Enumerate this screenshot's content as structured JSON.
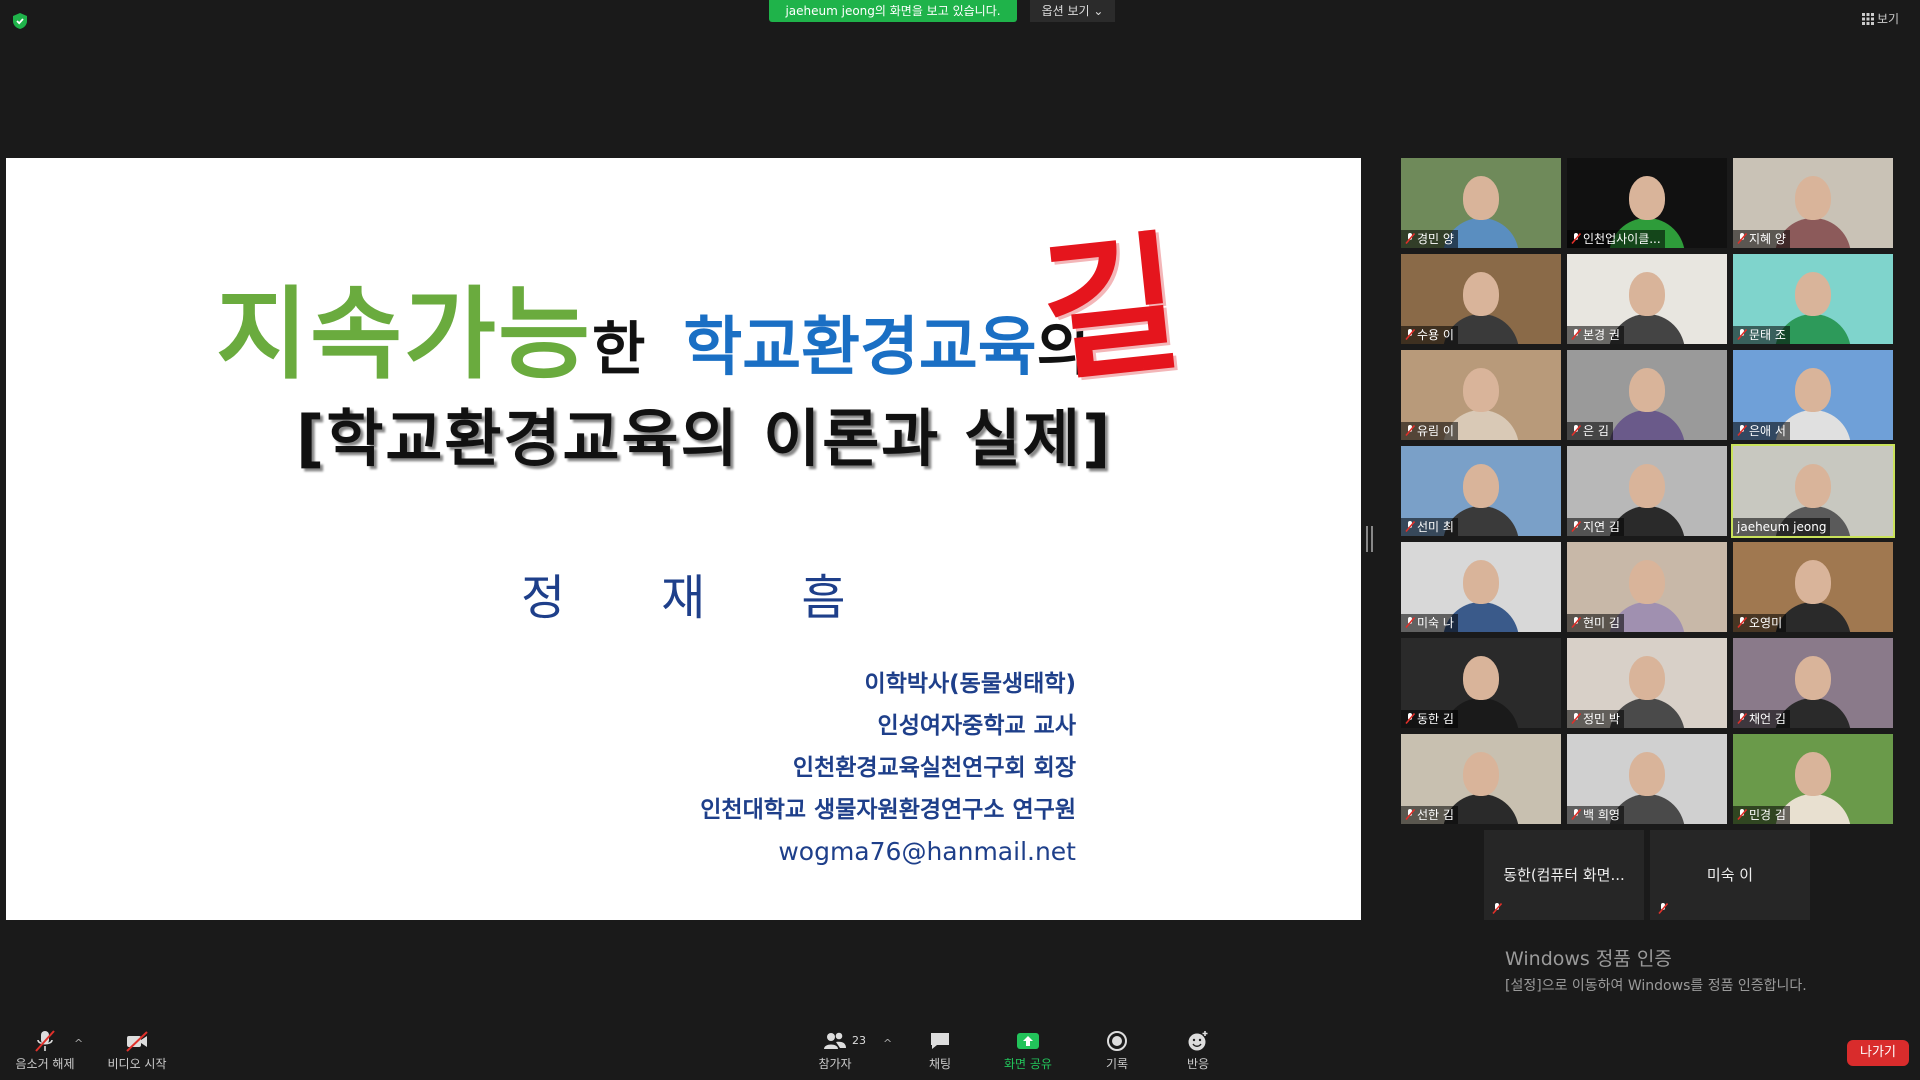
{
  "topbar": {
    "share_banner": "jaeheum jeong의 화면을 보고 있습니다.",
    "view_options": "옵션 보기 ⌄",
    "view_button": "보기"
  },
  "slide": {
    "title_green": "지속가능",
    "title_black1": "한",
    "title_blue": "학교환경교육",
    "title_black2": "의",
    "title_red": "길",
    "subtitle": "[학교환경교육의 이론과 실제]",
    "author": "정재흠",
    "bio": [
      "이학박사(동물생태학)",
      "인성여자중학교 교사",
      "인천환경교육실천연구회 회장",
      "인천대학교 생물자원환경연구소 연구원"
    ],
    "email": "wogma76@hanmail.net"
  },
  "participants": [
    {
      "name": "경민 양",
      "bg": "#6f8a5a",
      "shirt": "#5a8ec0"
    },
    {
      "name": "인천업사이클...",
      "bg": "#111111",
      "shirt": "#2e9c3a"
    },
    {
      "name": "지혜 양",
      "bg": "#c9c2b6",
      "shirt": "#8c5a5a"
    },
    {
      "name": "수용 이",
      "bg": "#8a6a48",
      "shirt": "#3a3a3a"
    },
    {
      "name": "본경 권",
      "bg": "#e8e6e0",
      "shirt": "#444444"
    },
    {
      "name": "문태 조",
      "bg": "#7fd4cc",
      "shirt": "#2d9a5a"
    },
    {
      "name": "유림 이",
      "bg": "#b89a7a",
      "shirt": "#d9c9b6"
    },
    {
      "name": "은 김",
      "bg": "#9a9a9a",
      "shirt": "#6a5a8a"
    },
    {
      "name": "은애 서",
      "bg": "#6fa0d8",
      "shirt": "#e0e0e0"
    },
    {
      "name": "선미 최",
      "bg": "#7aa0c8",
      "shirt": "#3a3a3a"
    },
    {
      "name": "지연 김",
      "bg": "#b8b8b8",
      "shirt": "#2a2a2a"
    },
    {
      "name": "jaeheum jeong",
      "bg": "#c8c8c0",
      "shirt": "#5a5a5a"
    },
    {
      "name": "미숙 나",
      "bg": "#d8d8d8",
      "shirt": "#3a5a8a"
    },
    {
      "name": "현미 김",
      "bg": "#c8b8a8",
      "shirt": "#a090b0"
    },
    {
      "name": "오영미",
      "bg": "#a07850",
      "shirt": "#2a2a2a"
    },
    {
      "name": "동한 김",
      "bg": "#2a2a2a",
      "shirt": "#1a1a1a"
    },
    {
      "name": "정민 박",
      "bg": "#d8d0c8",
      "shirt": "#4a4a4a"
    },
    {
      "name": "채언 김",
      "bg": "#8a7a8a",
      "shirt": "#2a2a2a"
    },
    {
      "name": "선한 김",
      "bg": "#c8c0b0",
      "shirt": "#2a2a2a"
    },
    {
      "name": "백 희영",
      "bg": "#d0d0d0",
      "shirt": "#4a4a4a"
    },
    {
      "name": "민경 김",
      "bg": "#6a9a4a",
      "shirt": "#e8e0d0"
    }
  ],
  "name_tiles": [
    {
      "name": "동한(컴퓨터 화면..."
    },
    {
      "name": "미숙 이"
    }
  ],
  "activation": {
    "line1": "Windows 정품 인증",
    "line2": "[설정]으로 이동하여 Windows를 정품 인증합니다."
  },
  "toolbar": {
    "unmute": "음소거 해제",
    "start_video": "비디오 시작",
    "participants": "참가자",
    "participants_count": "23",
    "chat": "채팅",
    "share_screen": "화면 공유",
    "record": "기록",
    "reactions": "반응",
    "leave": "나가기"
  },
  "colors": {
    "share_green": "#1fb34a",
    "leave_red": "#d92c2c",
    "active_speaker": "#c9e25a"
  }
}
